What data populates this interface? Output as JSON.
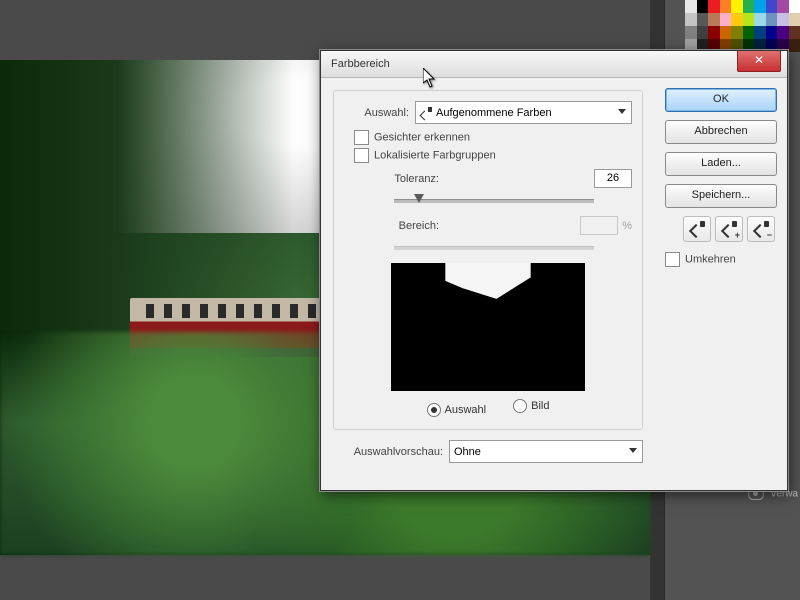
{
  "dialog": {
    "title": "Farbbereich",
    "auswahl_label": "Auswahl:",
    "auswahl_value": "Aufgenommene Farben",
    "detect_faces": "Gesichter erkennen",
    "localized_groups": "Lokalisierte Farbgruppen",
    "tolerance_label": "Toleranz:",
    "tolerance_value": "26",
    "range_label": "Bereich:",
    "range_value": "",
    "range_unit": "%",
    "radio_selection": "Auswahl",
    "radio_image": "Bild",
    "preview_label": "Auswahlvorschau:",
    "preview_value": "Ohne",
    "ok": "OK",
    "cancel": "Abbrechen",
    "load": "Laden...",
    "save": "Speichern...",
    "invert": "Umkehren"
  },
  "panels": {
    "verwalten": "Verwa"
  },
  "swatch_colors": [
    "#e6e6e6",
    "#000000",
    "#ed1c24",
    "#ff7f27",
    "#fff200",
    "#22b14c",
    "#00a2e8",
    "#3f48cc",
    "#a349a4",
    "#ffffff",
    "#c3c3c3",
    "#585858",
    "#b97a57",
    "#ffaec9",
    "#ffc90e",
    "#b5e61d",
    "#99d9ea",
    "#7092be",
    "#c8bfe7",
    "#e0d0b0",
    "#808080",
    "#404040",
    "#8b0000",
    "#cc6600",
    "#808000",
    "#006400",
    "#004080",
    "#00008b",
    "#4b0082",
    "#603020",
    "#a0a0a0",
    "#202020",
    "#550000",
    "#804000",
    "#505000",
    "#003300",
    "#002040",
    "#000055",
    "#2a004a",
    "#3a2010"
  ]
}
